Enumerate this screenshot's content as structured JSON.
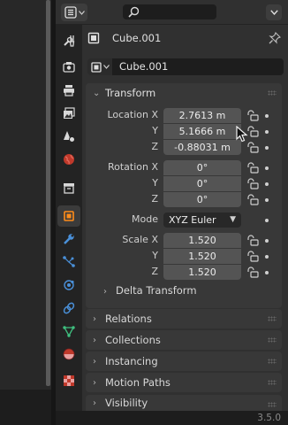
{
  "header": {
    "editor_type_icon": "properties-editor-icon",
    "search_placeholder": "",
    "dropdown_icon": "chevron-down-icon"
  },
  "tabs": [
    {
      "name": "tool-tab",
      "icon": "wrench-screwdriver-icon"
    },
    {
      "name": "render-tab",
      "icon": "camera-back-icon"
    },
    {
      "name": "output-tab",
      "icon": "printer-icon"
    },
    {
      "name": "view-layer-tab",
      "icon": "images-icon"
    },
    {
      "name": "scene-tab",
      "icon": "cone-sphere-icon"
    },
    {
      "name": "world-tab",
      "icon": "globe-icon"
    },
    {
      "name": "collection-tab",
      "icon": "box-icon"
    },
    {
      "name": "object-tab",
      "icon": "orange-square-icon",
      "active": true
    },
    {
      "name": "modifiers-tab",
      "icon": "wrench-icon"
    },
    {
      "name": "particles-tab",
      "icon": "particles-icon"
    },
    {
      "name": "physics-tab",
      "icon": "orbit-icon"
    },
    {
      "name": "constraints-tab",
      "icon": "link-icon"
    },
    {
      "name": "data-tab",
      "icon": "triangle-vertices-icon"
    },
    {
      "name": "material-tab",
      "icon": "sphere-material-icon"
    },
    {
      "name": "texture-tab",
      "icon": "checker-icon"
    }
  ],
  "object": {
    "title": "Cube.001",
    "name_field": "Cube.001"
  },
  "transform": {
    "header": "Transform",
    "location_label": "Location X",
    "y_label": "Y",
    "z_label": "Z",
    "location": [
      "2.7613 m",
      "5.1666 m",
      "-0.88031 m"
    ],
    "rotation_label": "Rotation X",
    "rotation": [
      "0°",
      "0°",
      "0°"
    ],
    "mode_label": "Mode",
    "mode_value": "XYZ Euler",
    "scale_label": "Scale X",
    "scale": [
      "1.520",
      "1.520",
      "1.520"
    ],
    "delta_header": "Delta Transform"
  },
  "panels": [
    "Relations",
    "Collections",
    "Instancing",
    "Motion Paths",
    "Visibility"
  ],
  "status": {
    "version": "3.5.0"
  },
  "colors": {
    "active_tab_accent": "#ff8c1a",
    "panel_bg": "#303030",
    "field_bg": "#545454"
  }
}
